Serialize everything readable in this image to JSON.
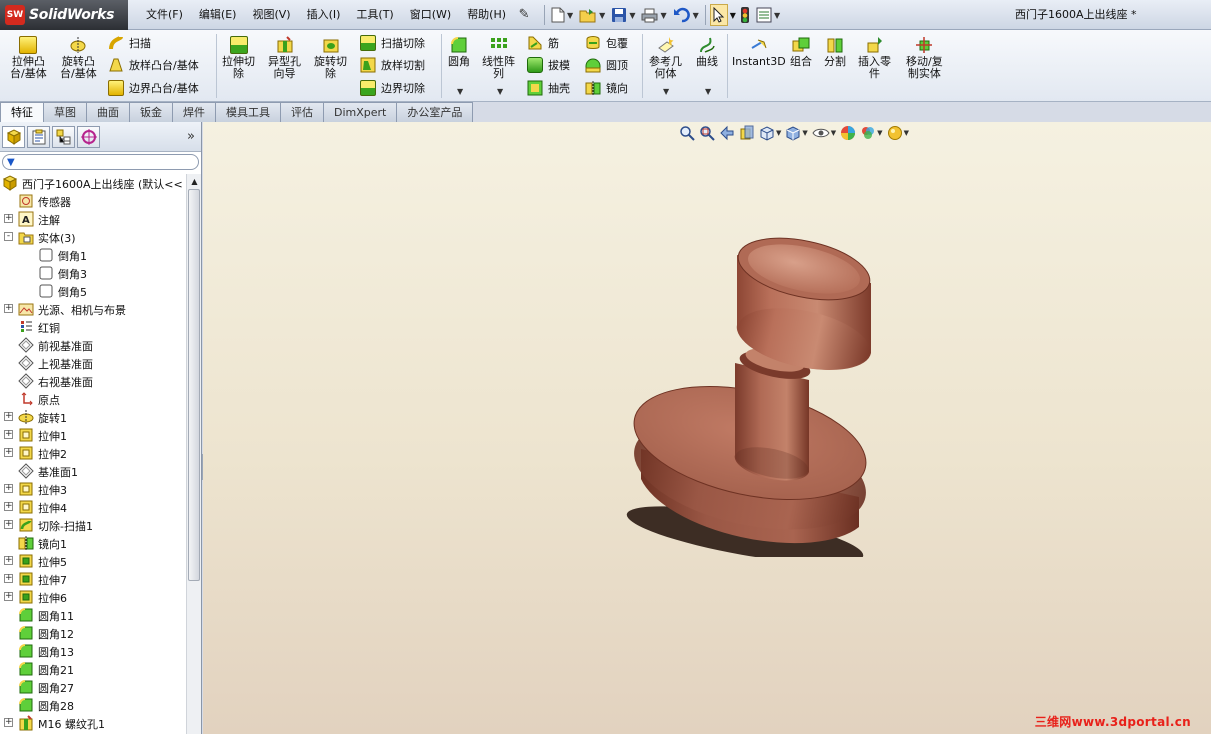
{
  "app": {
    "logo_mark": "SW",
    "logo_text": "SolidWorks",
    "doc_title": "西门子1600A上出线座 *"
  },
  "menu": {
    "items": [
      "文件(F)",
      "编辑(E)",
      "视图(V)",
      "插入(I)",
      "工具(T)",
      "窗口(W)",
      "帮助(H)"
    ]
  },
  "commands": {
    "extrude_boss": "拉伸凸\n台/基体",
    "revolve_boss": "旋转凸\n台/基体",
    "sweep": "扫描",
    "loft_boss": "放样凸台/基体",
    "boundary_boss": "边界凸台/基体",
    "extrude_cut": "拉伸切\n除",
    "hole_wizard": "异型孔\n向导",
    "revolve_cut": "旋转切\n除",
    "sweep_cut": "扫描切除",
    "loft_cut": "放样切割",
    "boundary_cut": "边界切除",
    "fillet": "圆角",
    "linear_pattern": "线性阵\n列",
    "rib": "筋",
    "draft": "拔模",
    "shell": "抽壳",
    "wrap": "包覆",
    "dome": "圆顶",
    "mirror": "镜向",
    "ref_geometry": "参考几\n何体",
    "curves": "曲线",
    "instant3d": "Instant3D",
    "combine": "组合",
    "split": "分割",
    "insert_part": "插入零\n件",
    "move_copy": "移动/复\n制实体"
  },
  "tabs": [
    {
      "label": "特征",
      "active": true
    },
    {
      "label": "草图",
      "active": false
    },
    {
      "label": "曲面",
      "active": false
    },
    {
      "label": "钣金",
      "active": false
    },
    {
      "label": "焊件",
      "active": false
    },
    {
      "label": "模具工具",
      "active": false
    },
    {
      "label": "评估",
      "active": false
    },
    {
      "label": "DimXpert",
      "active": false
    },
    {
      "label": "办公室产品",
      "active": false
    }
  ],
  "panel": {
    "expand_glyph": "»"
  },
  "tree": [
    {
      "label": "西门子1600A上出线座  (默认<<",
      "icon": "part-icon",
      "level": 0,
      "expander": ""
    },
    {
      "label": "传感器",
      "icon": "sensor-icon",
      "level": 1,
      "expander": ""
    },
    {
      "label": "注解",
      "icon": "annotation-icon",
      "level": 1,
      "expander": "+"
    },
    {
      "label": "实体(3)",
      "icon": "solid-bodies-icon",
      "level": 1,
      "expander": "-"
    },
    {
      "label": "倒角1",
      "icon": "body-icon",
      "level": 2,
      "expander": ""
    },
    {
      "label": "倒角3",
      "icon": "body-icon",
      "level": 2,
      "expander": ""
    },
    {
      "label": "倒角5",
      "icon": "body-icon",
      "level": 2,
      "expander": ""
    },
    {
      "label": "光源、相机与布景",
      "icon": "lights-icon",
      "level": 1,
      "expander": "+"
    },
    {
      "label": "红铜",
      "icon": "material-icon",
      "level": 1,
      "expander": ""
    },
    {
      "label": "前视基准面",
      "icon": "plane-icon",
      "level": 1,
      "expander": ""
    },
    {
      "label": "上视基准面",
      "icon": "plane-icon",
      "level": 1,
      "expander": ""
    },
    {
      "label": "右视基准面",
      "icon": "plane-icon",
      "level": 1,
      "expander": ""
    },
    {
      "label": "原点",
      "icon": "origin-icon",
      "level": 1,
      "expander": ""
    },
    {
      "label": "旋转1",
      "icon": "revolve-icon",
      "level": 1,
      "expander": "+"
    },
    {
      "label": "拉伸1",
      "icon": "extrude-icon",
      "level": 1,
      "expander": "+"
    },
    {
      "label": "拉伸2",
      "icon": "extrude-icon",
      "level": 1,
      "expander": "+"
    },
    {
      "label": "基准面1",
      "icon": "plane-icon",
      "level": 1,
      "expander": ""
    },
    {
      "label": "拉伸3",
      "icon": "extrude-icon",
      "level": 1,
      "expander": "+"
    },
    {
      "label": "拉伸4",
      "icon": "extrude-icon",
      "level": 1,
      "expander": "+"
    },
    {
      "label": "切除-扫描1",
      "icon": "cut-sweep-icon",
      "level": 1,
      "expander": "+"
    },
    {
      "label": "镜向1",
      "icon": "mirror-icon",
      "level": 1,
      "expander": ""
    },
    {
      "label": "拉伸5",
      "icon": "extrude-cut-icon",
      "level": 1,
      "expander": "+"
    },
    {
      "label": "拉伸7",
      "icon": "extrude-cut-icon",
      "level": 1,
      "expander": "+"
    },
    {
      "label": "拉伸6",
      "icon": "extrude-cut-icon",
      "level": 1,
      "expander": "+"
    },
    {
      "label": "圆角11",
      "icon": "fillet-icon",
      "level": 1,
      "expander": ""
    },
    {
      "label": "圆角12",
      "icon": "fillet-icon",
      "level": 1,
      "expander": ""
    },
    {
      "label": "圆角13",
      "icon": "fillet-icon",
      "level": 1,
      "expander": ""
    },
    {
      "label": "圆角21",
      "icon": "fillet-icon",
      "level": 1,
      "expander": ""
    },
    {
      "label": "圆角27",
      "icon": "fillet-icon",
      "level": 1,
      "expander": ""
    },
    {
      "label": "圆角28",
      "icon": "fillet-icon",
      "level": 1,
      "expander": ""
    },
    {
      "label": "M16 螺纹孔1",
      "icon": "hole-icon",
      "level": 1,
      "expander": "+"
    }
  ],
  "watermark": "三维网www.3dportal.cn",
  "colors": {
    "copper_light": "#c9806a",
    "copper_mid": "#b06a55",
    "copper_dark": "#7a3b2c",
    "viewport_top": "#f5f1e1",
    "viewport_bottom": "#e2d2bf"
  }
}
